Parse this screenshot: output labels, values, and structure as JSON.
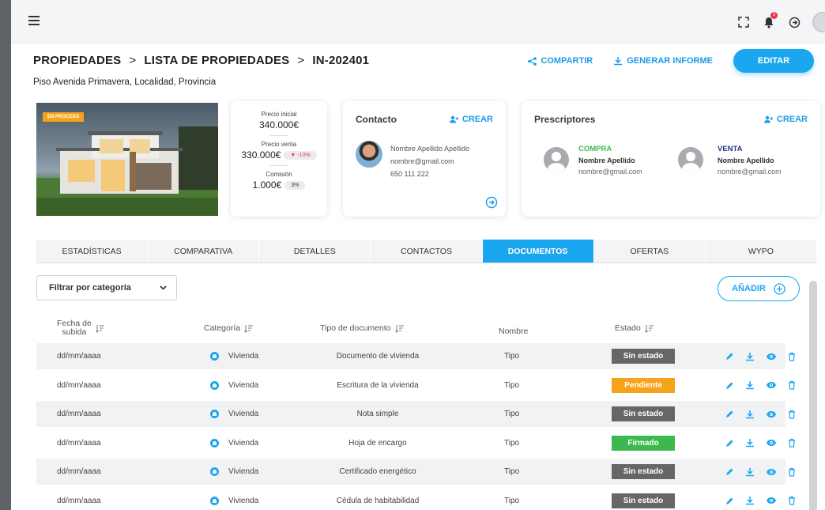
{
  "breadcrumb": {
    "level1": "PROPIEDADES",
    "level2": "LISTA DE PROPIEDADES",
    "level3": "IN-202401",
    "separator": ">"
  },
  "subtitle": "Piso Avenida Primavera, Localidad, Provincia",
  "actions": {
    "share": "COMPARTIR",
    "report": "GENERAR INFORME",
    "edit": "EDITAR"
  },
  "top_icons": {
    "notifications_count": "3"
  },
  "property": {
    "status_tag": "EN PROCESO"
  },
  "prices": {
    "initial_label": "Precio inicial",
    "initial_value": "340.000€",
    "sale_label": "Precio venta",
    "sale_value": "330.000€",
    "sale_change": "▼ -10%",
    "commission_label": "Comisión",
    "commission_value": "1.000€",
    "commission_pct": "3%"
  },
  "contact": {
    "title": "Contacto",
    "create": "CREAR",
    "name": "Nombre Apellido Apellido",
    "email": "nombre@gmail.com",
    "phone": "650 111 222"
  },
  "prescribers": {
    "title": "Prescriptores",
    "create": "CREAR",
    "items": [
      {
        "role": "COMPRA",
        "name": "Nombre Apellido",
        "email": "nombre@gmail.com"
      },
      {
        "role": "VENTA",
        "name": "Nombre Apellido",
        "email": "nombre@gmail.com"
      }
    ]
  },
  "tabs": [
    "ESTADÍSTICAS",
    "COMPARATIVA",
    "DETALLES",
    "CONTACTOS",
    "DOCUMENTOS",
    "OFERTAS",
    "WYPO"
  ],
  "active_tab": "DOCUMENTOS",
  "filter": {
    "label": "Filtrar por categoría"
  },
  "add_button": "AÑADIR",
  "table": {
    "headers": {
      "date_line1": "Fecha de",
      "date_line2": "subida",
      "category": "Categoría",
      "doc_type": "Tipo de documento",
      "name": "Nombre",
      "status": "Estado"
    },
    "rows": [
      {
        "date": "dd/mm/aaaa",
        "category": "Vivienda",
        "doc_type": "Documento de vivienda",
        "name": "Tipo",
        "status": "Sin estado"
      },
      {
        "date": "dd/mm/aaaa",
        "category": "Vivienda",
        "doc_type": "Escritura de la vivienda",
        "name": "Tipo",
        "status": "Pendiente"
      },
      {
        "date": "dd/mm/aaaa",
        "category": "Vivienda",
        "doc_type": "Nota simple",
        "name": "Tipo",
        "status": "Sin estado"
      },
      {
        "date": "dd/mm/aaaa",
        "category": "Vivienda",
        "doc_type": "Hoja de encargo",
        "name": "Tipo",
        "status": "Firmado"
      },
      {
        "date": "dd/mm/aaaa",
        "category": "Vivienda",
        "doc_type": "Certificado energético",
        "name": "Tipo",
        "status": "Sin estado"
      },
      {
        "date": "dd/mm/aaaa",
        "category": "Vivienda",
        "doc_type": "Cédula de habitabilidad",
        "name": "Tipo",
        "status": "Sin estado"
      }
    ]
  },
  "colors": {
    "accent": "#1ba6f0",
    "status_none": "#666666",
    "status_pending": "#f7a21b",
    "status_signed": "#3cb94e",
    "role_buy": "#3cb94e",
    "role_sell": "#1f3a8a"
  }
}
